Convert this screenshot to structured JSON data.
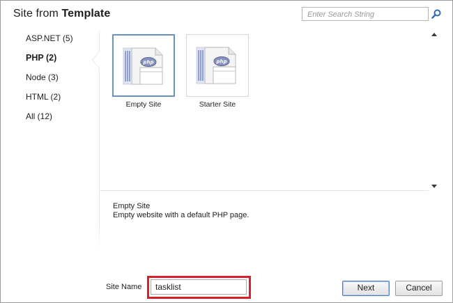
{
  "window": {
    "title_prefix": "Site from",
    "title_strong": "Template"
  },
  "search": {
    "placeholder": "Enter Search String",
    "value": ""
  },
  "categories": [
    {
      "label": "ASP.NET (5)",
      "selected": false
    },
    {
      "label": "PHP (2)",
      "selected": true
    },
    {
      "label": "Node (3)",
      "selected": false
    },
    {
      "label": "HTML (2)",
      "selected": false
    },
    {
      "label": "All (12)",
      "selected": false
    }
  ],
  "templates": [
    {
      "label": "Empty Site",
      "selected": true,
      "icon": "php-document-icon"
    },
    {
      "label": "Starter Site",
      "selected": false,
      "icon": "php-document-icon"
    }
  ],
  "description": {
    "title": "Empty Site",
    "text": "Empty website with a default PHP page."
  },
  "site_name": {
    "label": "Site Name",
    "value": "tasklist"
  },
  "buttons": {
    "next": "Next",
    "cancel": "Cancel"
  },
  "colors": {
    "selection_border": "#6b93c2",
    "highlight": "#d6202a",
    "php_badge": "#8892bf",
    "doc_stripe": "#3f5fb5"
  }
}
